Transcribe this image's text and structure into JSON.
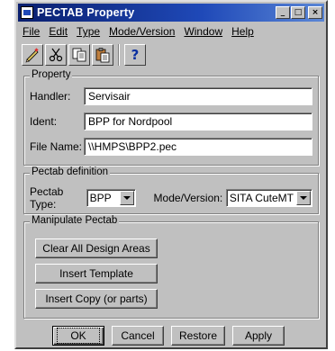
{
  "window": {
    "title": "PECTAB Property",
    "controls": [
      "_",
      "□",
      "×"
    ]
  },
  "menu": [
    "File",
    "Edit",
    "Type",
    "Mode/Version",
    "Window",
    "Help"
  ],
  "toolbar": {
    "icons": [
      "pencil-icon",
      "scissors-icon",
      "copy-icon",
      "paste-icon",
      "help-icon"
    ],
    "help_glyph": "?"
  },
  "property": {
    "legend": "Property",
    "handler_label": "Handler:",
    "handler_value": "Servisair",
    "ident_label": "Ident:",
    "ident_value": "BPP for Nordpool",
    "filename_label": "File Name:",
    "filename_value": "\\\\HMPS\\BPP2.pec"
  },
  "pectab_def": {
    "legend": "Pectab definition",
    "type_label": "Pectab Type:",
    "type_value": "BPP",
    "mode_label": "Mode/Version:",
    "mode_value": "SITA CuteMT"
  },
  "manipulate": {
    "legend": "Manipulate Pectab",
    "clear": "Clear All Design Areas",
    "insert_template": "Insert Template",
    "insert_copy": "Insert Copy (or parts)"
  },
  "footer": {
    "ok": "OK",
    "cancel": "Cancel",
    "restore": "Restore",
    "apply": "Apply"
  }
}
